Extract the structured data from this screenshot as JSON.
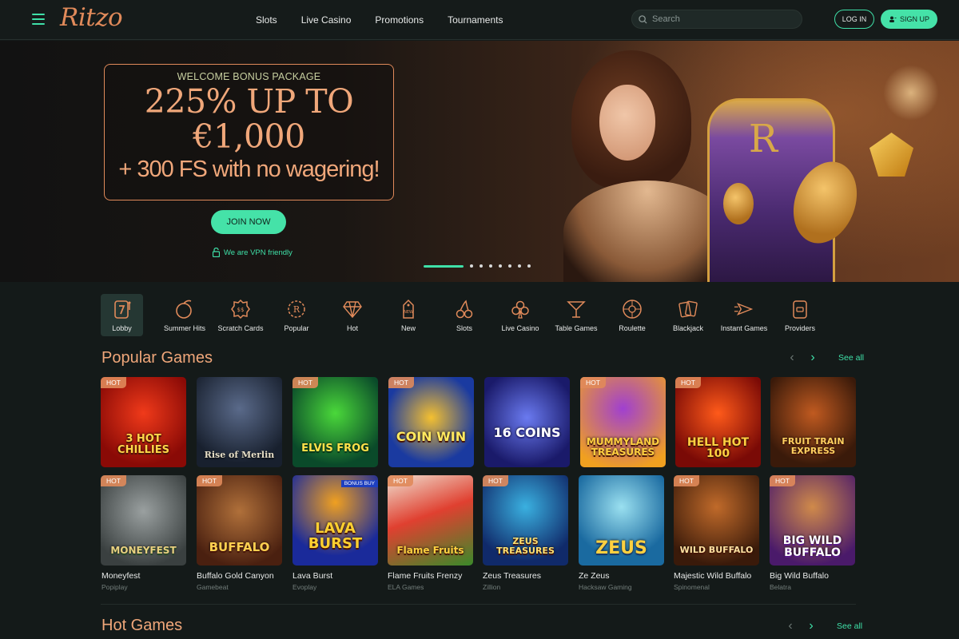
{
  "header": {
    "logo": "Ritzo",
    "nav": [
      "Slots",
      "Live Casino",
      "Promotions",
      "Tournaments"
    ],
    "search_placeholder": "Search",
    "login_label": "LOG IN",
    "signup_label": "SIGN UP"
  },
  "hero": {
    "eyebrow": "WELCOME BONUS PACKAGE",
    "line1": "225% UP TO",
    "line2": "€1,000",
    "line3": "+ 300 FS with no wagering!",
    "cta": "JOIN NOW",
    "vpn_note": "We are VPN friendly",
    "slide_count": 8,
    "active_slide": 1
  },
  "categories": [
    {
      "label": "Lobby",
      "icon": "seven-slot-icon"
    },
    {
      "label": "Summer Hits",
      "icon": "fruit-icon"
    },
    {
      "label": "Scratch Cards",
      "icon": "scratch-card-icon"
    },
    {
      "label": "Popular",
      "icon": "laurel-icon"
    },
    {
      "label": "Hot",
      "icon": "diamond-icon"
    },
    {
      "label": "New",
      "icon": "new-tag-icon"
    },
    {
      "label": "Slots",
      "icon": "cherries-icon"
    },
    {
      "label": "Live Casino",
      "icon": "clubs-icon"
    },
    {
      "label": "Table Games",
      "icon": "cocktail-icon"
    },
    {
      "label": "Roulette",
      "icon": "roulette-icon"
    },
    {
      "label": "Blackjack",
      "icon": "cards-icon"
    },
    {
      "label": "Instant Games",
      "icon": "rocket-icon"
    },
    {
      "label": "Providers",
      "icon": "providers-icon"
    }
  ],
  "popular": {
    "title": "Popular Games",
    "see_all": "See all",
    "row1": [
      {
        "art": "3 HOT CHILLIES",
        "hot": "HOT"
      },
      {
        "art": "Rise of Merlin",
        "hot": ""
      },
      {
        "art": "ELVIS FROG",
        "hot": "HOT"
      },
      {
        "art": "COIN WIN",
        "hot": "HOT"
      },
      {
        "art": "16 COINS",
        "hot": ""
      },
      {
        "art": "MUMMYLAND TREASURES",
        "hot": "HOT"
      },
      {
        "art": "HELL HOT 100",
        "hot": "HOT"
      },
      {
        "art": "FRUIT TRAIN EXPRESS",
        "hot": ""
      }
    ],
    "row2": [
      {
        "name": "Moneyfest",
        "provider": "Popiplay",
        "art": "MONEYFEST",
        "hot": "HOT"
      },
      {
        "name": "Buffalo Gold Canyon",
        "provider": "Gamebeat",
        "art": "BUFFALO",
        "hot": "HOT"
      },
      {
        "name": "Lava Burst",
        "provider": "Evoplay",
        "art": "LAVA BURST",
        "hot": "",
        "bonus": "BONUS BUY"
      },
      {
        "name": "Flame Fruits Frenzy",
        "provider": "ELA Games",
        "art": "Flame Fruits",
        "hot": "HOT"
      },
      {
        "name": "Zeus Treasures",
        "provider": "Zillion",
        "art": "ZEUS TREASURES",
        "hot": "HOT"
      },
      {
        "name": "Ze Zeus",
        "provider": "Hacksaw Gaming",
        "art": "ZEUS",
        "hot": ""
      },
      {
        "name": "Majestic Wild Buffalo",
        "provider": "Spinomenal",
        "art": "WILD BUFFALO",
        "hot": "HOT"
      },
      {
        "name": "Big Wild Buffalo",
        "provider": "Belatra",
        "art": "BIG WILD BUFFALO",
        "hot": "HOT"
      }
    ]
  },
  "hot_games": {
    "title": "Hot Games",
    "see_all": "See all"
  },
  "colors": {
    "accent": "#45e2a8",
    "orange": "#f0a77a",
    "bg": "#141a19"
  }
}
